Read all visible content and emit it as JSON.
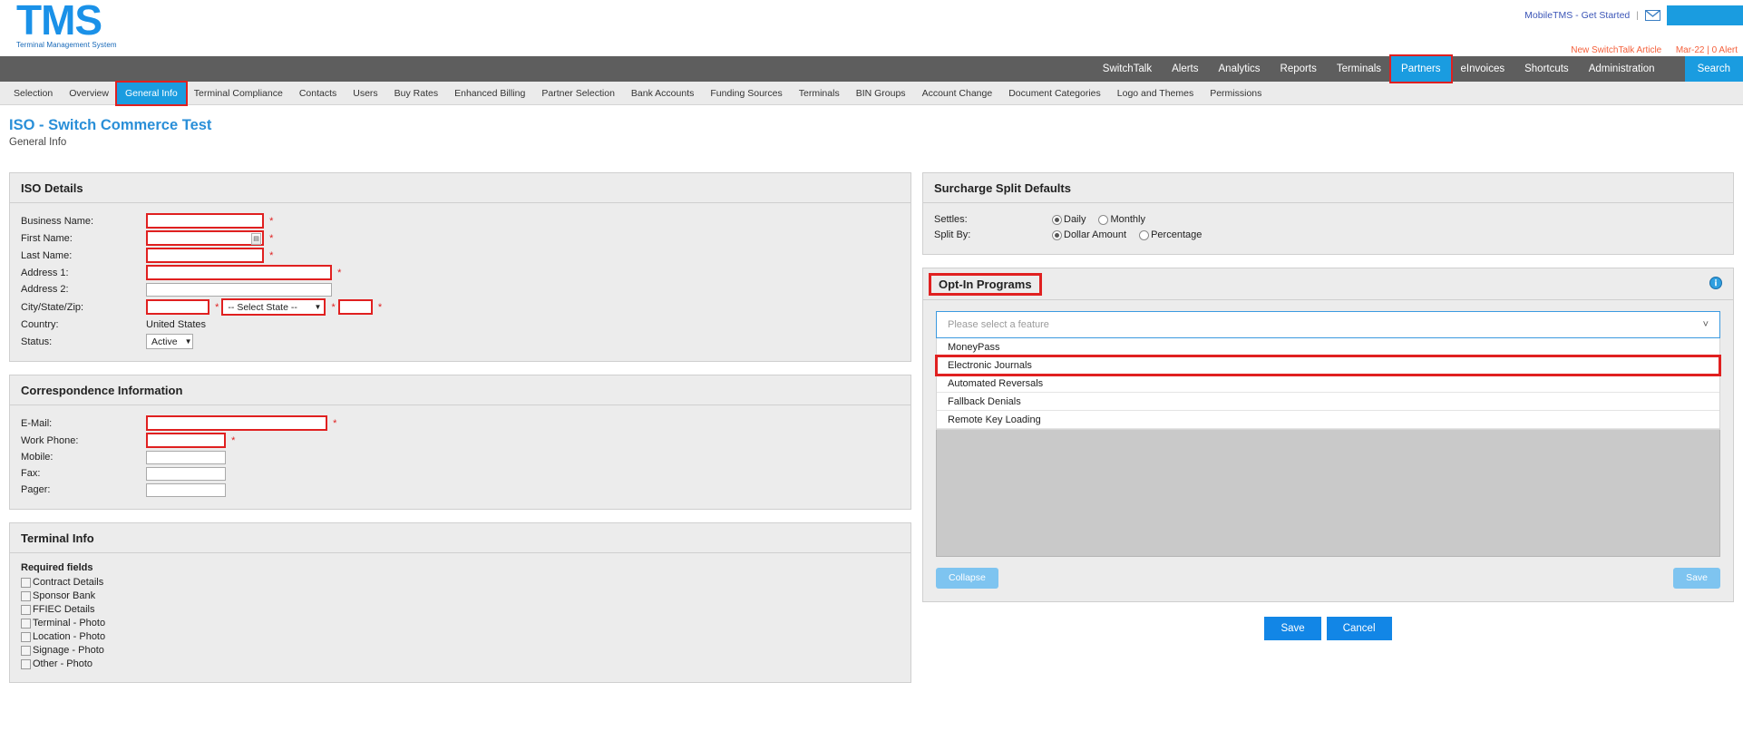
{
  "header": {
    "logo_text": "TMS",
    "logo_subtitle": "Terminal Management System",
    "mobile_link": "MobileTMS - Get Started",
    "separator": "|",
    "mail_icon": "mail-icon",
    "alert_text": "New SwitchTalk Article",
    "alert_meta": "Mar-22 | 0 Alert"
  },
  "mainnav": {
    "items": [
      {
        "label": "SwitchTalk",
        "active": false
      },
      {
        "label": "Alerts",
        "active": false
      },
      {
        "label": "Analytics",
        "active": false
      },
      {
        "label": "Reports",
        "active": false
      },
      {
        "label": "Terminals",
        "active": false
      },
      {
        "label": "Partners",
        "active": true
      },
      {
        "label": "eInvoices",
        "active": false
      },
      {
        "label": "Shortcuts",
        "active": false
      },
      {
        "label": "Administration",
        "active": false
      }
    ],
    "search_label": "Search"
  },
  "subnav": {
    "items": [
      {
        "label": "Selection",
        "active": false
      },
      {
        "label": "Overview",
        "active": false
      },
      {
        "label": "General Info",
        "active": true
      },
      {
        "label": "Terminal Compliance",
        "active": false
      },
      {
        "label": "Contacts",
        "active": false
      },
      {
        "label": "Users",
        "active": false
      },
      {
        "label": "Buy Rates",
        "active": false
      },
      {
        "label": "Enhanced Billing",
        "active": false
      },
      {
        "label": "Partner Selection",
        "active": false
      },
      {
        "label": "Bank Accounts",
        "active": false
      },
      {
        "label": "Funding Sources",
        "active": false
      },
      {
        "label": "Terminals",
        "active": false
      },
      {
        "label": "BIN Groups",
        "active": false
      },
      {
        "label": "Account Change",
        "active": false
      },
      {
        "label": "Document Categories",
        "active": false
      },
      {
        "label": "Logo and Themes",
        "active": false
      },
      {
        "label": "Permissions",
        "active": false
      }
    ]
  },
  "page": {
    "title": "ISO - Switch Commerce Test",
    "subtitle": "General Info"
  },
  "iso_details": {
    "heading": "ISO Details",
    "labels": {
      "business_name": "Business Name:",
      "first_name": "First Name:",
      "last_name": "Last Name:",
      "address1": "Address 1:",
      "address2": "Address 2:",
      "city_state_zip": "City/State/Zip:",
      "country": "Country:",
      "status": "Status:"
    },
    "values": {
      "business_name": "",
      "first_name": "",
      "last_name": "",
      "address1": "",
      "address2": "",
      "city": "",
      "state": "-- Select State --",
      "zip": "",
      "country": "United States",
      "status": "Active"
    },
    "required_marker": "*"
  },
  "correspondence": {
    "heading": "Correspondence Information",
    "labels": {
      "email": "E-Mail:",
      "work_phone": "Work Phone:",
      "mobile": "Mobile:",
      "fax": "Fax:",
      "pager": "Pager:"
    },
    "values": {
      "email": "",
      "work_phone": "",
      "mobile": "",
      "fax": "",
      "pager": ""
    }
  },
  "terminal_info": {
    "heading": "Terminal Info",
    "required_fields_label": "Required fields",
    "checkboxes": [
      {
        "label": "Contract Details",
        "checked": false
      },
      {
        "label": "Sponsor Bank",
        "checked": false
      },
      {
        "label": "FFIEC Details",
        "checked": false
      },
      {
        "label": "Terminal - Photo",
        "checked": false
      },
      {
        "label": "Location - Photo",
        "checked": false
      },
      {
        "label": "Signage - Photo",
        "checked": false
      },
      {
        "label": "Other - Photo",
        "checked": false
      }
    ]
  },
  "surcharge": {
    "heading": "Surcharge Split Defaults",
    "settles_label": "Settles:",
    "settles_options": [
      {
        "label": "Daily",
        "selected": true
      },
      {
        "label": "Monthly",
        "selected": false
      }
    ],
    "split_by_label": "Split By:",
    "split_by_options": [
      {
        "label": "Dollar Amount",
        "selected": true
      },
      {
        "label": "Percentage",
        "selected": false
      }
    ]
  },
  "optin": {
    "heading": "Opt-In Programs",
    "info_icon": "info-icon",
    "select_placeholder": "Please select a feature",
    "chevron": "chevron-down-icon",
    "options": [
      {
        "label": "MoneyPass",
        "highlighted": false
      },
      {
        "label": "Electronic Journals",
        "highlighted": true
      },
      {
        "label": "Automated Reversals",
        "highlighted": false
      },
      {
        "label": "Fallback Denials",
        "highlighted": false
      },
      {
        "label": "Remote Key Loading",
        "highlighted": false
      }
    ],
    "collapse_label": "Collapse",
    "save_label": "Save"
  },
  "footer": {
    "save_label": "Save",
    "cancel_label": "Cancel"
  },
  "colors": {
    "brand_blue": "#1a9ce0",
    "nav_gray": "#5e5e5e",
    "highlight_red": "#e02020",
    "title_blue": "#2a8fd8",
    "alert_red": "#f4603c"
  }
}
